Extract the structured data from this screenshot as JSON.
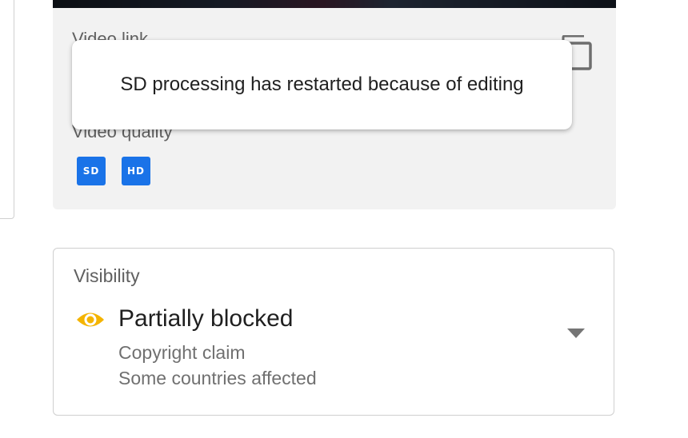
{
  "video_details": {
    "video_link_label": "Video link",
    "video_quality_label": "Video quality",
    "quality_badges": [
      "SD",
      "HD"
    ],
    "copy_icon": "copy-icon"
  },
  "toast": {
    "message": "SD processing has restarted because of editing"
  },
  "visibility": {
    "label": "Visibility",
    "status": "Partially blocked",
    "status_icon": "eye-icon",
    "status_color": "#f4b400",
    "detail_lines": [
      "Copyright claim",
      "Some countries affected"
    ],
    "dropdown_icon": "dropdown-arrow-icon"
  },
  "colors": {
    "badge": "#1a73e8",
    "card_background": "#f2f2f2"
  }
}
